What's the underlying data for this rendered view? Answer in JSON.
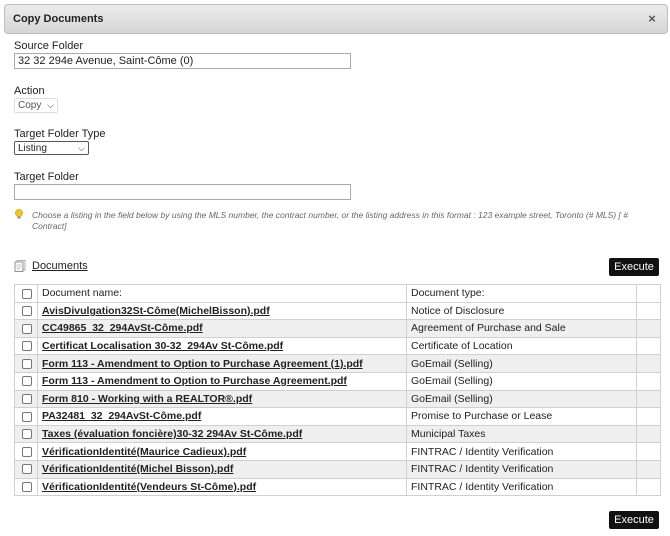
{
  "dialog": {
    "title": "Copy Documents",
    "close_icon": "×"
  },
  "form": {
    "source_folder_label": "Source Folder",
    "source_folder_value": "32 32 294e Avenue, Saint-Côme  (0)",
    "action_label": "Action",
    "action_value": "Copy",
    "target_type_label": "Target Folder Type",
    "target_type_value": "Listing",
    "target_folder_label": "Target Folder",
    "target_folder_value": "",
    "hint": "Choose a listing in the field below by using the MLS number, the contract number, or the listing address in this format : 123 example street, Toronto (# MLS) [ # Contract]"
  },
  "documents": {
    "heading": "Documents",
    "execute_label": "Execute",
    "col_name": "Document name:",
    "col_type": "Document type:",
    "rows": [
      {
        "name": "AvisDivulgation32St-Côme(MichelBisson).pdf",
        "type": "Notice of Disclosure"
      },
      {
        "name": "CC49865_32_294AvSt-Côme.pdf",
        "type": "Agreement of Purchase and Sale"
      },
      {
        "name": "Certificat Localisation 30-32_294Av St-Côme.pdf",
        "type": "Certificate of Location"
      },
      {
        "name": "Form 113 - Amendment to Option to Purchase Agreement (1).pdf",
        "type": "GoEmail (Selling)"
      },
      {
        "name": "Form 113 - Amendment to Option to Purchase Agreement.pdf",
        "type": "GoEmail (Selling)"
      },
      {
        "name": "Form 810 - Working with a REALTOR®.pdf",
        "type": "GoEmail (Selling)"
      },
      {
        "name": "PA32481_32_294AvSt-Côme.pdf",
        "type": "Promise to Purchase or Lease"
      },
      {
        "name": "Taxes (évaluation foncière)30-32 294Av St-Côme.pdf",
        "type": "Municipal Taxes"
      },
      {
        "name": "VérificationIdentité(Maurice Cadieux).pdf",
        "type": "FINTRAC / Identity Verification"
      },
      {
        "name": "VérificationIdentité(Michel Bisson).pdf",
        "type": "FINTRAC / Identity Verification"
      },
      {
        "name": "VérificationIdentité(Vendeurs St-Côme).pdf",
        "type": "FINTRAC / Identity Verification"
      }
    ]
  },
  "footer": {
    "execute_label": "Execute"
  }
}
